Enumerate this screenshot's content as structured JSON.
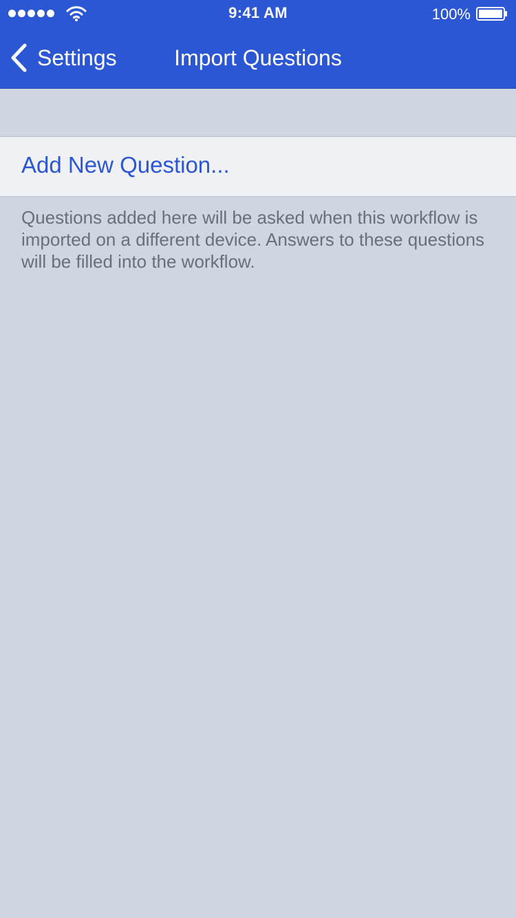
{
  "status_bar": {
    "time": "9:41 AM",
    "battery_percent": "100%",
    "signal_bars": 5,
    "icons": [
      "signal-dots-icon",
      "wifi-icon",
      "battery-icon"
    ]
  },
  "nav": {
    "back_label": "Settings",
    "title": "Import Questions",
    "back_icon": "chevron-left-icon"
  },
  "list": {
    "add_label": "Add New Question..."
  },
  "footer_note": "Questions added here will be asked when this workflow is imported on a different device. Answers to these questions will be filled into the workflow.",
  "colors": {
    "accent": "#2B57D4",
    "background": "#CFD6E1",
    "cell_background": "#EFF1F5",
    "footer_text": "#6A6F78"
  }
}
